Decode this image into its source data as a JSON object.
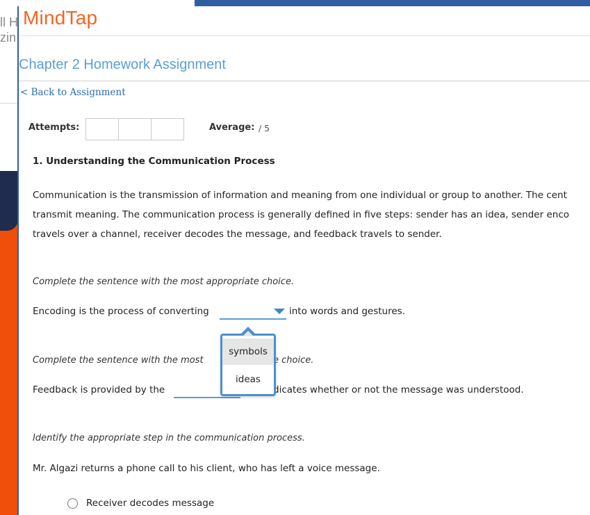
{
  "background": {
    "partial_text_line1": "ll H",
    "partial_text_line2": "zin"
  },
  "app": {
    "logo": "MindTap",
    "brand_color": "#f26522",
    "accent_color": "#4b90cf"
  },
  "page": {
    "title": "Chapter 2 Homework Assignment",
    "back_link": "< Back to Assignment"
  },
  "score": {
    "attempts_label": "Attempts:",
    "attempt_boxes": 3,
    "average_label": "Average:",
    "average_value": "/ 5"
  },
  "question": {
    "heading": "1. Understanding the Communication Process",
    "paragraph_lines": [
      "Communication is the transmission of information and meaning from one individual or group to another. The cent",
      "transmit meaning. The communication process is generally defined in five steps: sender has an idea, sender enco",
      "travels over a channel, receiver decodes the message, and feedback travels to sender."
    ],
    "part1": {
      "instruction": "Complete the sentence with the most appropriate choice.",
      "before": "Encoding is the process of converting",
      "after": "into words and gestures.",
      "dropdown_options": [
        "symbols",
        "ideas"
      ],
      "highlighted_option": "symbols"
    },
    "part2": {
      "instruction_left": "Complete the sentence with the most",
      "instruction_right": "e choice.",
      "before": "Feedback is provided by the",
      "after": "and indicates whether or not the message was understood."
    },
    "part3": {
      "instruction": "Identify the appropriate step in the communication process.",
      "scenario": "Mr. Algazi returns a phone call to his client, who has left a voice message.",
      "options": [
        "Receiver decodes message"
      ]
    }
  }
}
